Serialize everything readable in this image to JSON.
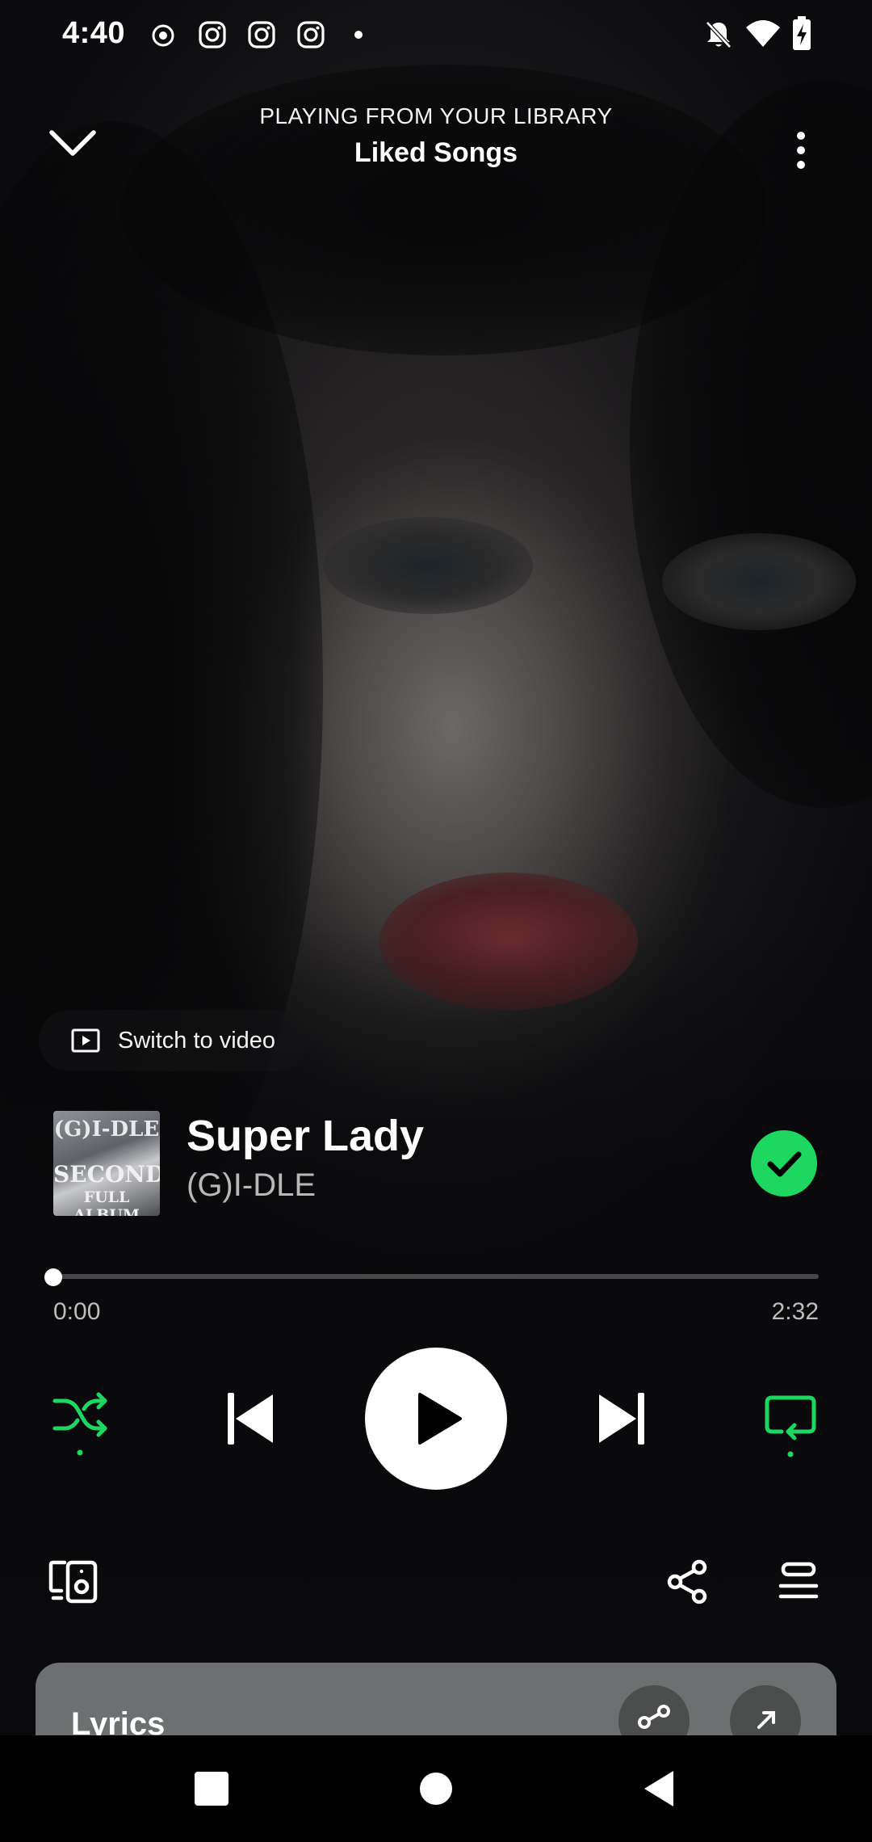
{
  "status_bar": {
    "time": "4:40",
    "left_icons": [
      "record-icon",
      "instagram-icon",
      "instagram-icon",
      "instagram-icon",
      "dot-icon"
    ],
    "right_icons": [
      "notifications-off-icon",
      "wifi-icon",
      "battery-charging-icon"
    ]
  },
  "header": {
    "subtitle": "PLAYING FROM YOUR LIBRARY",
    "title": "Liked Songs",
    "collapse_icon": "chevron-down-icon",
    "more_icon": "more-vertical-icon"
  },
  "switch_video": {
    "label": "Switch to video",
    "icon": "video-icon"
  },
  "track": {
    "title": "Super Lady",
    "artist": "(G)I-DLE",
    "cover_text": [
      "(G)I-DLE",
      "SECOND",
      "FULL ALBUM"
    ],
    "liked": true
  },
  "playback": {
    "elapsed": "0:00",
    "duration": "2:32",
    "progress_fraction": 0.0
  },
  "controls": {
    "shuffle_icon": "shuffle-icon",
    "previous_icon": "skip-previous-icon",
    "play_icon": "play-icon",
    "next_icon": "skip-next-icon",
    "repeat_icon": "repeat-icon"
  },
  "bottom_actions": {
    "devices_icon": "connect-device-icon",
    "share_icon": "share-icon",
    "queue_icon": "queue-icon"
  },
  "lyrics": {
    "title": "Lyrics"
  },
  "colors": {
    "accent": "#1ed760",
    "background": "#0b0b0d",
    "lyrics_card": "#6d7070"
  },
  "navigation": {
    "icons": [
      "recents-icon",
      "home-icon",
      "back-icon"
    ]
  }
}
